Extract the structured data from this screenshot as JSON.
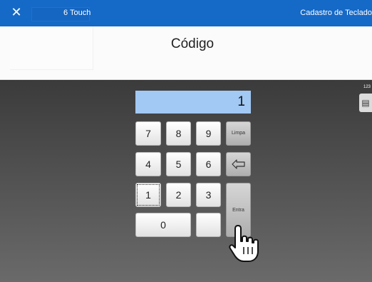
{
  "titlebar": {
    "close_glyph": "✕",
    "app_title": "6 Touch",
    "window_title": "Cadastro de Teclado"
  },
  "header": {
    "heading": "Código"
  },
  "display": {
    "value": "1"
  },
  "side_panel": {
    "label": "123",
    "icon": "numeric-keypad-icon",
    "glyph": "▤"
  },
  "keypad": {
    "keys": {
      "k7": "7",
      "k8": "8",
      "k9": "9",
      "k4": "4",
      "k5": "5",
      "k6": "6",
      "k1": "1",
      "k2": "2",
      "k3": "3",
      "k0": "0",
      "blank": ""
    },
    "clear_label": "Limpa",
    "backspace_icon": "backspace-arrow-icon",
    "enter_label": "Entra"
  },
  "cursor_icon": "hand-pointer-icon"
}
